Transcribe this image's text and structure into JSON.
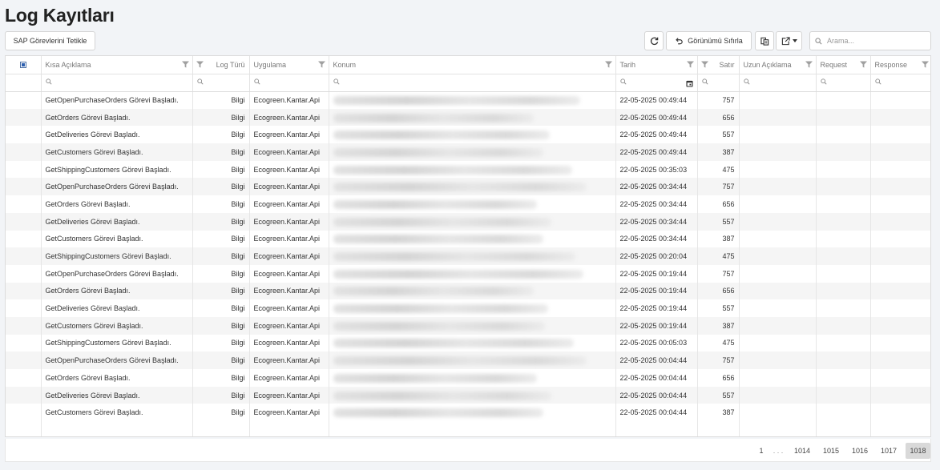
{
  "page": {
    "title": "Log Kayıtları"
  },
  "toolbar": {
    "sap_button": "SAP Görevlerini Tetikle",
    "reset_view": "Görünümü Sıfırla",
    "search_placeholder": "Arama..."
  },
  "columns": {
    "short_desc": "Kısa Açıklama",
    "log_type": "Log Türü",
    "application": "Uygulama",
    "location": "Konum",
    "date": "Tarih",
    "line": "Satır",
    "long_desc": "Uzun Açıklama",
    "request": "Request",
    "response": "Response"
  },
  "rows": [
    {
      "desc": "GetOpenPurchaseOrders Görevi Başladı.",
      "type": "Bilgi",
      "app": "Ecogreen.Kantar.Api",
      "date": "22-05-2025 00:49:44",
      "line": "757"
    },
    {
      "desc": "GetOrders Görevi Başladı.",
      "type": "Bilgi",
      "app": "Ecogreen.Kantar.Api",
      "date": "22-05-2025 00:49:44",
      "line": "656"
    },
    {
      "desc": "GetDeliveries Görevi Başladı.",
      "type": "Bilgi",
      "app": "Ecogreen.Kantar.Api",
      "date": "22-05-2025 00:49:44",
      "line": "557"
    },
    {
      "desc": "GetCustomers Görevi Başladı.",
      "type": "Bilgi",
      "app": "Ecogreen.Kantar.Api",
      "date": "22-05-2025 00:49:44",
      "line": "387"
    },
    {
      "desc": "GetShippingCustomers Görevi Başladı.",
      "type": "Bilgi",
      "app": "Ecogreen.Kantar.Api",
      "date": "22-05-2025 00:35:03",
      "line": "475"
    },
    {
      "desc": "GetOpenPurchaseOrders Görevi Başladı.",
      "type": "Bilgi",
      "app": "Ecogreen.Kantar.Api",
      "date": "22-05-2025 00:34:44",
      "line": "757"
    },
    {
      "desc": "GetOrders Görevi Başladı.",
      "type": "Bilgi",
      "app": "Ecogreen.Kantar.Api",
      "date": "22-05-2025 00:34:44",
      "line": "656"
    },
    {
      "desc": "GetDeliveries Görevi Başladı.",
      "type": "Bilgi",
      "app": "Ecogreen.Kantar.Api",
      "date": "22-05-2025 00:34:44",
      "line": "557"
    },
    {
      "desc": "GetCustomers Görevi Başladı.",
      "type": "Bilgi",
      "app": "Ecogreen.Kantar.Api",
      "date": "22-05-2025 00:34:44",
      "line": "387"
    },
    {
      "desc": "GetShippingCustomers Görevi Başladı.",
      "type": "Bilgi",
      "app": "Ecogreen.Kantar.Api",
      "date": "22-05-2025 00:20:04",
      "line": "475"
    },
    {
      "desc": "GetOpenPurchaseOrders Görevi Başladı.",
      "type": "Bilgi",
      "app": "Ecogreen.Kantar.Api",
      "date": "22-05-2025 00:19:44",
      "line": "757"
    },
    {
      "desc": "GetOrders Görevi Başladı.",
      "type": "Bilgi",
      "app": "Ecogreen.Kantar.Api",
      "date": "22-05-2025 00:19:44",
      "line": "656"
    },
    {
      "desc": "GetDeliveries Görevi Başladı.",
      "type": "Bilgi",
      "app": "Ecogreen.Kantar.Api",
      "date": "22-05-2025 00:19:44",
      "line": "557"
    },
    {
      "desc": "GetCustomers Görevi Başladı.",
      "type": "Bilgi",
      "app": "Ecogreen.Kantar.Api",
      "date": "22-05-2025 00:19:44",
      "line": "387"
    },
    {
      "desc": "GetShippingCustomers Görevi Başladı.",
      "type": "Bilgi",
      "app": "Ecogreen.Kantar.Api",
      "date": "22-05-2025 00:05:03",
      "line": "475"
    },
    {
      "desc": "GetOpenPurchaseOrders Görevi Başladı.",
      "type": "Bilgi",
      "app": "Ecogreen.Kantar.Api",
      "date": "22-05-2025 00:04:44",
      "line": "757"
    },
    {
      "desc": "GetOrders Görevi Başladı.",
      "type": "Bilgi",
      "app": "Ecogreen.Kantar.Api",
      "date": "22-05-2025 00:04:44",
      "line": "656"
    },
    {
      "desc": "GetDeliveries Görevi Başladı.",
      "type": "Bilgi",
      "app": "Ecogreen.Kantar.Api",
      "date": "22-05-2025 00:04:44",
      "line": "557"
    },
    {
      "desc": "GetCustomers Görevi Başladı.",
      "type": "Bilgi",
      "app": "Ecogreen.Kantar.Api",
      "date": "22-05-2025 00:04:44",
      "line": "387"
    }
  ],
  "pagination": {
    "first": "1",
    "ellipsis": ". . .",
    "pages": [
      "1014",
      "1015",
      "1016",
      "1017",
      "1018"
    ],
    "active": "1018"
  },
  "colors": {
    "accent": "#337ab7",
    "stripe": "#f5f5f5",
    "active_page": "#d9d9d9"
  },
  "icons": [
    "refresh-icon",
    "undo-icon",
    "column-chooser-icon",
    "export-icon",
    "search-icon",
    "filter-icon",
    "calendar-icon"
  ]
}
